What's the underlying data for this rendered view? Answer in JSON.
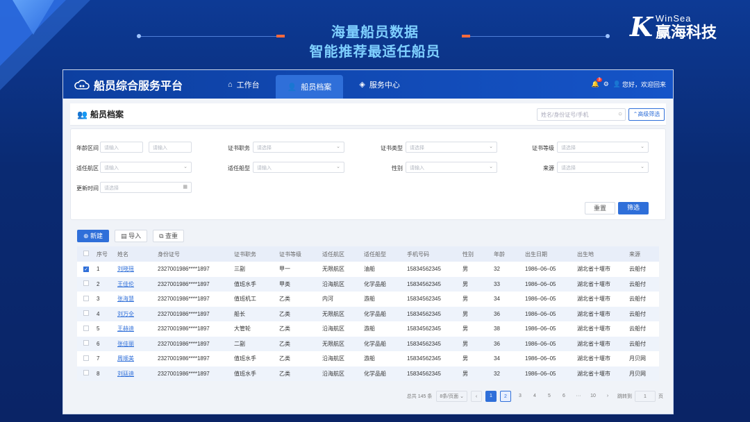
{
  "hero": {
    "line1": "海量船员数据",
    "line2": "智能推荐最适任船员"
  },
  "brand": {
    "mark": "K",
    "en": "WinSea",
    "cn": "赢海科技"
  },
  "app": {
    "title": "船员综合服务平台",
    "nav": [
      {
        "label": "工作台",
        "icon": "workbench-icon"
      },
      {
        "label": "船员档案",
        "icon": "crew-icon",
        "active": true
      },
      {
        "label": "服务中心",
        "icon": "cube-icon"
      }
    ],
    "greeting": "您好，欢迎回来",
    "bell_count": "3"
  },
  "panel": {
    "title": "船员档案",
    "search_placeholder": "姓名/身份证号/手机",
    "advanced_filter": "高级筛选"
  },
  "filters": {
    "age_label": "年龄区间",
    "age_min": "请输入",
    "age_max": "请输入",
    "cert_duty_label": "证书职务",
    "cert_duty": "请选择",
    "cert_type_label": "证书类型",
    "cert_type": "请选择",
    "cert_level_label": "证书等级",
    "cert_level": "请选择",
    "nav_area_label": "适任航区",
    "nav_area": "请输入",
    "ship_type_label": "适任船型",
    "ship_type": "请输入",
    "gender_label": "性别",
    "gender": "请输入",
    "source_label": "来源",
    "source": "请选择",
    "update_label": "更新时间",
    "update": "请选择",
    "reset": "重置",
    "apply": "筛选"
  },
  "toolbar": {
    "new": "新建",
    "import": "导入",
    "query": "查重"
  },
  "table": {
    "headers": [
      "序号",
      "姓名",
      "身份证号",
      "证书职务",
      "证书等级",
      "适任航区",
      "适任船型",
      "手机号码",
      "性别",
      "年龄",
      "出生日期",
      "出生地",
      "来源"
    ],
    "rows": [
      {
        "no": "1",
        "name": "刘晓瑶",
        "id": "2327001986****1897",
        "duty": "三副",
        "level": "甲一",
        "area": "无限航区",
        "ship": "油船",
        "phone": "15834562345",
        "sex": "男",
        "age": "32",
        "birth": "1986–06–05",
        "place": "湖北省十堰市",
        "src": "云船付",
        "checked": true
      },
      {
        "no": "2",
        "name": "王佳伦",
        "id": "2327001986****1897",
        "duty": "值班水手",
        "level": "甲类",
        "area": "沿海航区",
        "ship": "化学品船",
        "phone": "15834562345",
        "sex": "男",
        "age": "33",
        "birth": "1986–06–05",
        "place": "湖北省十堰市",
        "src": "云船付"
      },
      {
        "no": "3",
        "name": "张海慧",
        "id": "2327001986****1897",
        "duty": "值班机工",
        "level": "乙类",
        "area": "内河",
        "ship": "游船",
        "phone": "15834562345",
        "sex": "男",
        "age": "34",
        "birth": "1986–06–05",
        "place": "湖北省十堰市",
        "src": "云船付"
      },
      {
        "no": "4",
        "name": "刘万全",
        "id": "2327001986****1897",
        "duty": "船长",
        "level": "乙类",
        "area": "无限航区",
        "ship": "化学品船",
        "phone": "15834562345",
        "sex": "男",
        "age": "36",
        "birth": "1986–06–05",
        "place": "湖北省十堰市",
        "src": "云船付"
      },
      {
        "no": "5",
        "name": "王赫迪",
        "id": "2327001986****1897",
        "duty": "大管轮",
        "level": "乙类",
        "area": "沿海航区",
        "ship": "游船",
        "phone": "15834562345",
        "sex": "男",
        "age": "38",
        "birth": "1986–06–05",
        "place": "湖北省十堰市",
        "src": "云船付"
      },
      {
        "no": "6",
        "name": "张佳丽",
        "id": "2327001986****1897",
        "duty": "二副",
        "level": "乙类",
        "area": "无限航区",
        "ship": "化学品船",
        "phone": "15834562345",
        "sex": "男",
        "age": "36",
        "birth": "1986–06–05",
        "place": "湖北省十堰市",
        "src": "云船付"
      },
      {
        "no": "7",
        "name": "周顺美",
        "id": "2327001986****1897",
        "duty": "值班水手",
        "level": "乙类",
        "area": "沿海航区",
        "ship": "游船",
        "phone": "15834562345",
        "sex": "男",
        "age": "34",
        "birth": "1986–06–05",
        "place": "湖北省十堰市",
        "src": "月贝网"
      },
      {
        "no": "8",
        "name": "刘廷迪",
        "id": "2327001986****1897",
        "duty": "值班水手",
        "level": "乙类",
        "area": "沿海航区",
        "ship": "化学品船",
        "phone": "15834562345",
        "sex": "男",
        "age": "32",
        "birth": "1986–06–05",
        "place": "湖北省十堰市",
        "src": "月贝网"
      }
    ]
  },
  "pager": {
    "total": "总共 145 条",
    "size": "8条/页面",
    "pages": [
      "1",
      "2",
      "3",
      "4",
      "5",
      "6",
      "···",
      "10"
    ],
    "goto_label": "跳转到",
    "goto_value": "1",
    "page_unit": "页",
    "prev": "‹",
    "next": "›"
  },
  "colors": {
    "primary": "#2f6fd9",
    "topbar": "#1554c8",
    "bg": "#0b2a73",
    "accent": "#ff6a3d"
  }
}
